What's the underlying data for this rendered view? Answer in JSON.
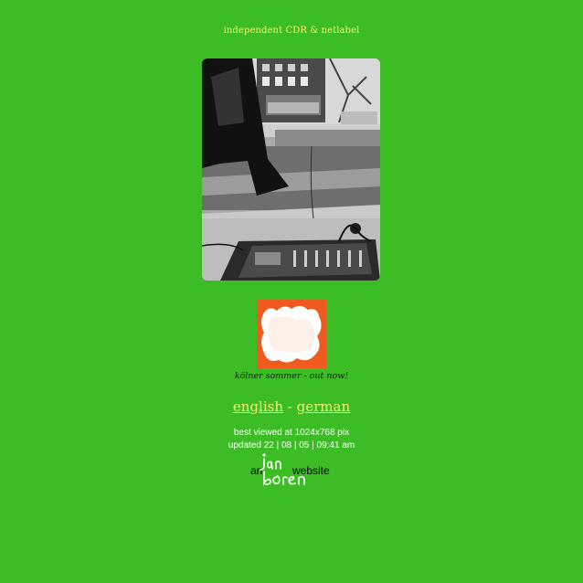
{
  "header": {
    "tagline": "independent CDR & netlabel"
  },
  "hero_image": {
    "description_icon": "street-photo-with-mixer"
  },
  "release": {
    "cover_icon": "orange-white-cover-art",
    "caption": "kölner sommer - out now!"
  },
  "languages": {
    "english": "english",
    "separator": "-",
    "german": "german"
  },
  "footer": {
    "best_viewed": "best viewed at 1024x768 pix",
    "updated": "updated 22 | 08 | 05 | 09:41 am",
    "credit_prefix": "an",
    "credit_suffix": "website",
    "credit_signature": "jan boren"
  },
  "colors": {
    "background": "#3dbd25",
    "accent_yellow": "#f3f36a",
    "cover_orange": "#f05a1e"
  }
}
